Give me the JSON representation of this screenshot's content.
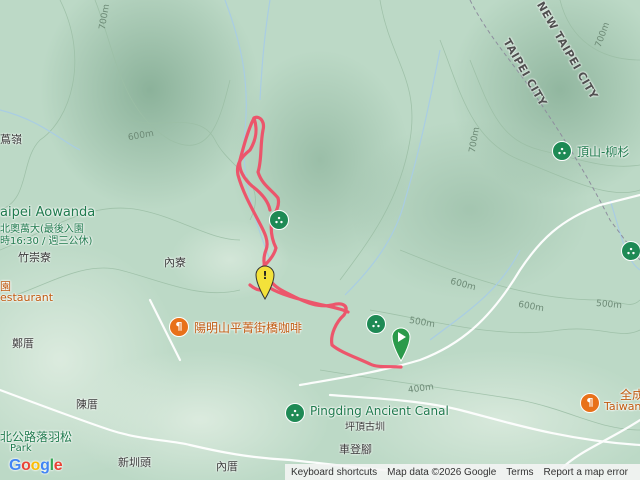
{
  "map": {
    "contours": [
      "700m",
      "600m",
      "700m",
      "500m",
      "600m",
      "600m",
      "500m",
      "400m",
      "700m"
    ],
    "city_labels": [
      "NEW TAIPEI CITY",
      "TAIPEI CITY"
    ],
    "places": [
      "竹崇寮",
      "內寮",
      "鄭厝",
      "陳厝",
      "新圳頭",
      "內厝",
      "車登腳",
      "坪頂古圳",
      "蔦嶺"
    ],
    "partial_labels": [
      "aipei Aowanda",
      "北奧萬大(最後入園",
      "時16:30 / 週三公休)",
      "園",
      "estaurant",
      "北公路落羽松",
      "Park"
    ],
    "pois": {
      "cafe": "陽明山平菁街橋咖啡",
      "canal": "Pingding Ancient Canal",
      "mountain": "頂山-柳杉",
      "right_partial": "全成",
      "right_partial_en": "Taiwan"
    },
    "footer": {
      "shortcuts": "Keyboard shortcuts",
      "map_data": "Map data ©2026 Google",
      "terms": "Terms",
      "report": "Report a map error"
    },
    "logo": "Google",
    "colors": {
      "track": "#ef4f67",
      "terrain": "#bcd9c6",
      "poi_green": "#1e8a55",
      "poi_orange": "#e8711a"
    }
  }
}
